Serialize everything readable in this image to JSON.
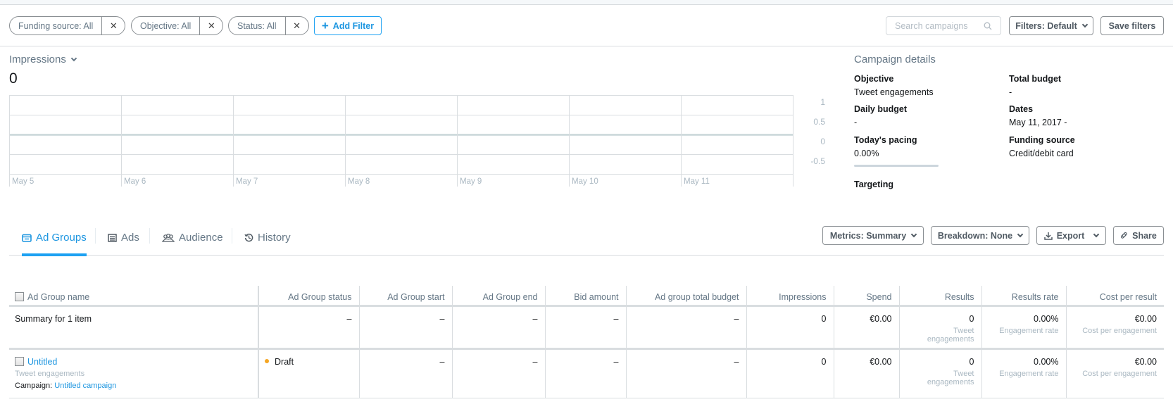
{
  "filters": {
    "pills": [
      {
        "label": "Funding source: All"
      },
      {
        "label": "Objective: All"
      },
      {
        "label": "Status: All"
      }
    ],
    "remove_glyph": "✕",
    "add_filter_label": "Add Filter",
    "search_placeholder": "Search campaigns",
    "filters_default_label": "Filters: Default",
    "save_filters_label": "Save filters"
  },
  "metric": {
    "label": "Impressions",
    "value": "0"
  },
  "chart_data": {
    "type": "line",
    "title": "Impressions",
    "x": [
      "May 5",
      "May 6",
      "May 7",
      "May 8",
      "May 9",
      "May 10",
      "May 11"
    ],
    "series": [
      {
        "name": "Impressions",
        "values": []
      }
    ],
    "y_ticks": [
      "1",
      "0.5",
      "0",
      "-0.5"
    ],
    "ylim": [
      -1,
      1
    ],
    "grid": true,
    "xlabel": "",
    "ylabel": ""
  },
  "campaign_details": {
    "title": "Campaign details",
    "objective_label": "Objective",
    "objective_value": "Tweet engagements",
    "total_budget_label": "Total budget",
    "total_budget_value": "-",
    "daily_budget_label": "Daily budget",
    "daily_budget_value": "-",
    "dates_label": "Dates",
    "dates_value": "May 11, 2017 -",
    "pacing_label": "Today's pacing",
    "pacing_value": "0.00%",
    "pacing_fraction": 0,
    "funding_label": "Funding source",
    "funding_value": "Credit/debit card",
    "targeting_label": "Targeting"
  },
  "tabs": [
    {
      "label": "Ad Groups",
      "icon": "ad-groups-icon",
      "active": true
    },
    {
      "label": "Ads",
      "icon": "ads-icon"
    },
    {
      "label": "Audience",
      "icon": "audience-icon"
    },
    {
      "label": "History",
      "icon": "history-icon"
    }
  ],
  "toolbar": {
    "metrics_label": "Metrics: Summary",
    "breakdown_label": "Breakdown: None",
    "export_label": "Export",
    "share_label": "Share"
  },
  "table": {
    "columns": [
      "Ad Group name",
      "Ad Group status",
      "Ad Group start",
      "Ad Group end",
      "Bid amount",
      "Ad group total budget",
      "Impressions",
      "Spend",
      "Results",
      "Results rate",
      "Cost per result"
    ],
    "summary": {
      "name": "Summary for 1 item",
      "status": "–",
      "start": "–",
      "end": "–",
      "bid": "–",
      "budget": "–",
      "impressions": "0",
      "spend": "€0.00",
      "results": "0",
      "results_sub": "Tweet engagements",
      "rate": "0.00%",
      "rate_sub": "Engagement rate",
      "cost": "€0.00",
      "cost_sub": "Cost per engagement"
    },
    "rows": [
      {
        "name": "Untitled",
        "objective": "Tweet engagements",
        "campaign_label": "Campaign:",
        "campaign_name": "Untitled campaign",
        "status": "Draft",
        "status_color": "#f5a623",
        "start": "–",
        "end": "–",
        "bid": "–",
        "budget": "–",
        "impressions": "0",
        "spend": "€0.00",
        "results": "0",
        "results_sub": "Tweet engagements",
        "rate": "0.00%",
        "rate_sub": "Engagement rate",
        "cost": "€0.00",
        "cost_sub": "Cost per engagement"
      }
    ]
  }
}
